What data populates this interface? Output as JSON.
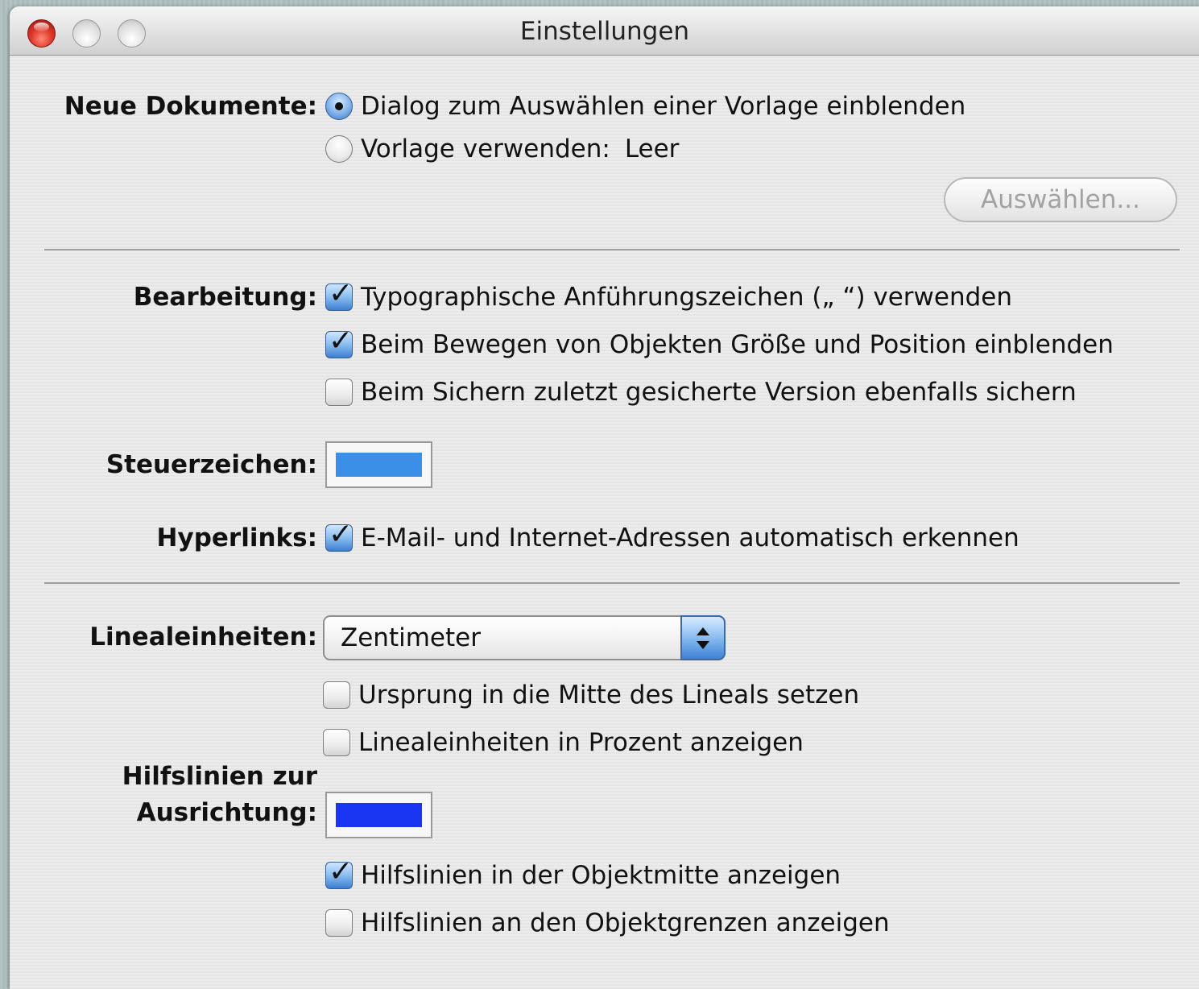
{
  "window": {
    "title": "Einstellungen"
  },
  "new_documents": {
    "label": "Neue Dokumente:",
    "option_dialog": "Dialog zum Auswählen einer Vorlage einblenden",
    "option_template": "Vorlage verwenden:",
    "template_value": "Leer",
    "selected": "dialog",
    "choose_button": "Auswählen..."
  },
  "editing": {
    "label": "Bearbeitung:",
    "smart_quotes": {
      "label": "Typographische Anführungszeichen („ “) verwenden",
      "checked": true
    },
    "show_size_position": {
      "label": "Beim Bewegen von Objekten Größe und Position einblenden",
      "checked": true
    },
    "backup_on_save": {
      "label": "Beim Sichern zuletzt gesicherte Version ebenfalls sichern",
      "checked": false
    }
  },
  "invisibles": {
    "label": "Steuerzeichen:",
    "color": "#3b8fe6"
  },
  "hyperlinks": {
    "label": "Hyperlinks:",
    "auto_detect": {
      "label": "E-Mail- und Internet-Adressen automatisch erkennen",
      "checked": true
    }
  },
  "ruler": {
    "label": "Linealeinheiten:",
    "unit": "Zentimeter",
    "origin_center": {
      "label": "Ursprung in die Mitte des Lineals setzen",
      "checked": false
    },
    "percent": {
      "label": "Linealeinheiten in Prozent anzeigen",
      "checked": false
    }
  },
  "alignment_guides": {
    "label_line1": "Hilfslinien zur",
    "label_line2": "Ausrichtung:",
    "color": "#1a36f2",
    "show_center": {
      "label": "Hilfslinien in der Objektmitte anzeigen",
      "checked": true
    },
    "show_edges": {
      "label": "Hilfslinien an den Objektgrenzen anzeigen",
      "checked": false
    }
  }
}
